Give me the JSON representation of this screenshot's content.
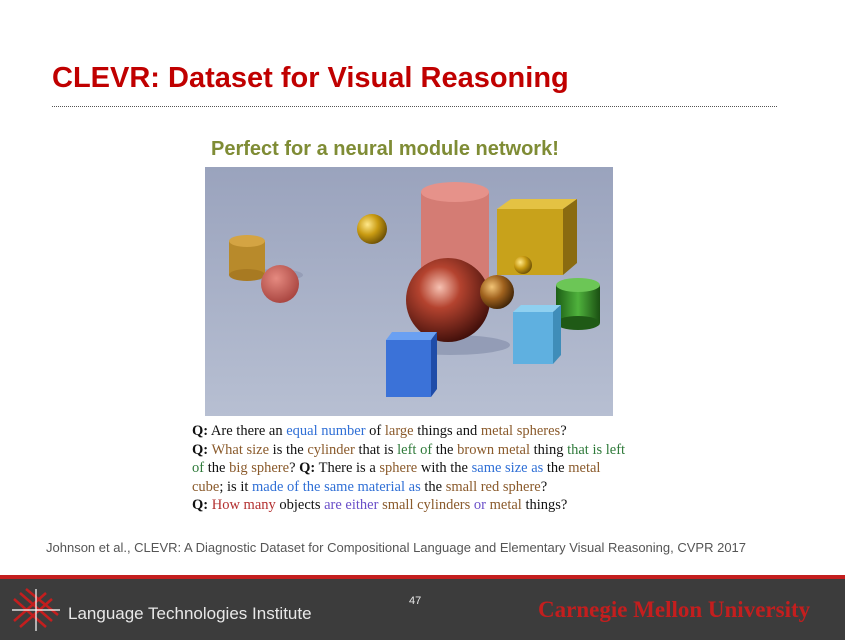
{
  "slide": {
    "title": "CLEVR: Dataset for Visual Reasoning",
    "subtitle": "Perfect for a neural module network!",
    "citation": "Johnson et al., CLEVR: A Diagnostic Dataset for Compositional Language and Elementary Visual Reasoning, CVPR 2017",
    "page_number": "47"
  },
  "qa": [
    {
      "prefix": "Q:",
      "segments": [
        {
          "text": " Are there an ",
          "color": "plain"
        },
        {
          "text": "equal number",
          "color": "blue"
        },
        {
          "text": " of ",
          "color": "plain"
        },
        {
          "text": "large",
          "color": "brown"
        },
        {
          "text": " things and ",
          "color": "plain"
        },
        {
          "text": "metal spheres",
          "color": "brown"
        },
        {
          "text": "?",
          "color": "plain"
        }
      ]
    },
    {
      "prefix": "Q:",
      "segments": [
        {
          "text": " What size",
          "color": "brown"
        },
        {
          "text": " is the ",
          "color": "plain"
        },
        {
          "text": "cylinder",
          "color": "brown"
        },
        {
          "text": " that is ",
          "color": "plain"
        },
        {
          "text": "left of",
          "color": "green"
        },
        {
          "text": " the ",
          "color": "plain"
        },
        {
          "text": "brown metal",
          "color": "brown"
        },
        {
          "text": " thing ",
          "color": "plain"
        },
        {
          "text": "that is left of",
          "color": "green"
        },
        {
          "text": " the ",
          "color": "plain"
        },
        {
          "text": "big sphere",
          "color": "brown"
        },
        {
          "text": "? ",
          "color": "plain"
        }
      ]
    },
    {
      "prefix": "Q:",
      "segments": [
        {
          "text": " There is a ",
          "color": "plain"
        },
        {
          "text": "sphere",
          "color": "brown"
        },
        {
          "text": " with the ",
          "color": "plain"
        },
        {
          "text": "same size as",
          "color": "blue"
        },
        {
          "text": " the ",
          "color": "plain"
        },
        {
          "text": "metal cube",
          "color": "brown"
        },
        {
          "text": "; is it ",
          "color": "plain"
        },
        {
          "text": "made of the same material as",
          "color": "blue"
        },
        {
          "text": " the ",
          "color": "plain"
        },
        {
          "text": "small red sphere",
          "color": "brown"
        },
        {
          "text": "?",
          "color": "plain"
        }
      ]
    },
    {
      "prefix": "Q:",
      "segments": [
        {
          "text": " How many",
          "color": "red"
        },
        {
          "text": " objects ",
          "color": "plain"
        },
        {
          "text": "are either",
          "color": "purple"
        },
        {
          "text": " ",
          "color": "plain"
        },
        {
          "text": "small cylinders",
          "color": "brown"
        },
        {
          "text": " ",
          "color": "plain"
        },
        {
          "text": "or",
          "color": "purple"
        },
        {
          "text": " ",
          "color": "plain"
        },
        {
          "text": "metal",
          "color": "brown"
        },
        {
          "text": " things?",
          "color": "plain"
        }
      ]
    }
  ],
  "footer": {
    "institute": "Language Technologies Institute",
    "university": "Carnegie Mellon University"
  },
  "colors": {
    "title": "#c00000",
    "subtitle": "#7f8c35",
    "footer_bg": "#3c3c3c",
    "footer_accent": "#c41e1e"
  }
}
